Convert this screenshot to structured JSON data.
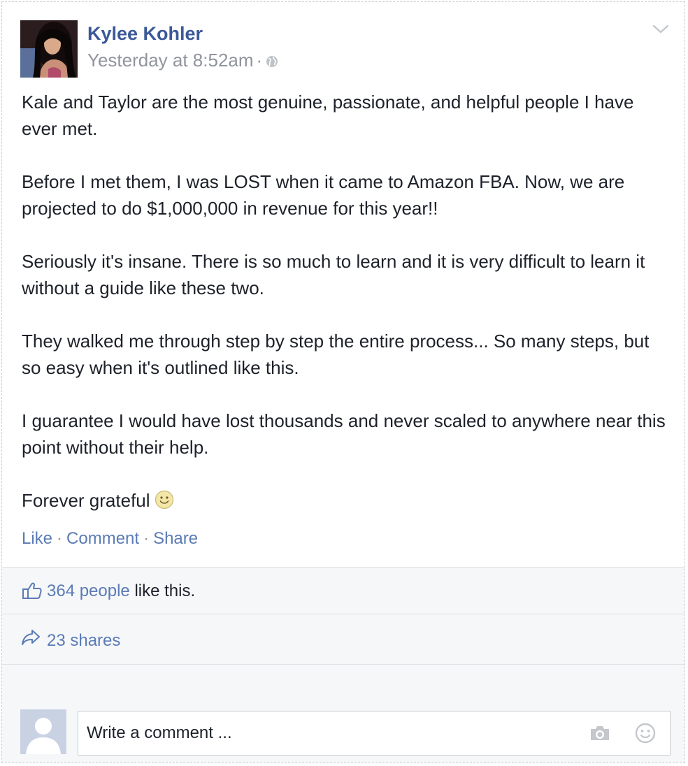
{
  "post": {
    "author": "Kylee Kohler",
    "timestamp": "Yesterday at 8:52am",
    "meta_separator": "·",
    "privacy_icon": "globe-icon",
    "menu_icon": "chevron-down-icon",
    "paragraphs": [
      "Kale and Taylor are the most genuine, passionate, and helpful people I have ever met.",
      "Before I met them, I was LOST when it came to Amazon FBA. Now, we are projected to do $1,000,000 in revenue for this year!!",
      "Seriously it's insane. There is so much to learn and it is very difficult to learn it without a guide like these two.",
      "They walked me through step by step the entire process... So many steps, but so easy when it's outlined like this.",
      "I guarantee I would have lost thousands and never scaled to anywhere near this point without their help."
    ],
    "closing_line": "Forever grateful",
    "closing_emoji": "smiley-icon"
  },
  "actions": {
    "like": "Like",
    "comment": "Comment",
    "share": "Share",
    "separator": "·"
  },
  "reactions": {
    "likes_count_text": "364 people",
    "likes_suffix": " like this.",
    "shares_text": "23 shares"
  },
  "composer": {
    "placeholder": "Write a comment ...",
    "camera_icon": "camera-icon",
    "emoji_icon": "smiley-icon"
  },
  "colors": {
    "link": "#5b7bb5",
    "author": "#3b5998",
    "meta": "#90949c",
    "text": "#1d2129",
    "band": "#f6f7f9"
  }
}
